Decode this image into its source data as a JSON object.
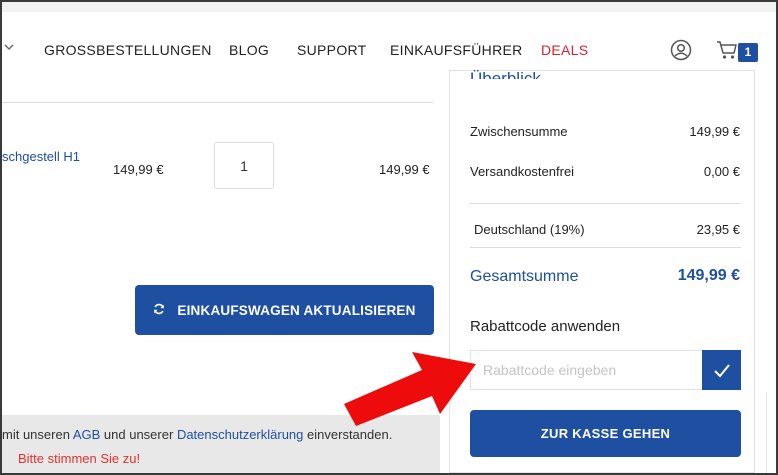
{
  "nav": {
    "items": [
      "GROSSBESTELLUNGEN",
      "BLOG",
      "SUPPORT",
      "EINKAUFSFÜHRER",
      "DEALS"
    ],
    "cart_count": "1",
    "accent_color": "#1f4fa0",
    "deals_color": "#d9232e"
  },
  "cart": {
    "product_name": "schgestell H1",
    "unit_price": "149,99 €",
    "quantity": "1",
    "line_total": "149,99 €",
    "update_button": "EINKAUFSWAGEN AKTUALISIEREN"
  },
  "terms": {
    "prefix": "mit unseren",
    "agb_link": "AGB",
    "middle": "und unserer",
    "privacy_link": "Datenschutzerklärung",
    "suffix": "einverstanden.",
    "error": "Bitte stimmen Sie zu!"
  },
  "summary": {
    "title": "Überblick",
    "subtotal_label": "Zwischensumme",
    "subtotal_value": "149,99 €",
    "shipping_label": "Versandkostenfrei",
    "shipping_value": "0,00 €",
    "tax_label": "Deutschland (19%)",
    "tax_value": "23,95 €",
    "total_label": "Gesamtsumme",
    "total_value": "149,99 €",
    "coupon_title": "Rabattcode anwenden",
    "coupon_placeholder": "Rabattcode eingeben",
    "checkout_button": "ZUR KASSE GEHEN"
  },
  "icons": {
    "account": "user-icon",
    "cart": "cart-icon",
    "apply": "checkmark-icon",
    "refresh": "refresh-icon",
    "annotation": "red-arrow-icon"
  }
}
